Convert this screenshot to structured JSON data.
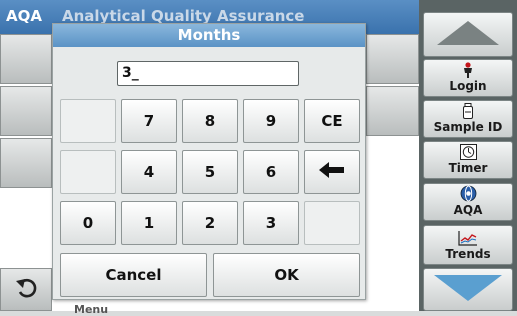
{
  "app": {
    "title_abbr": "AQA",
    "title_full": "Analytical Quality Assurance",
    "menu_label": "Menu"
  },
  "dialog": {
    "title": "Months",
    "input_value": "3_",
    "keys": {
      "k7": "7",
      "k8": "8",
      "k9": "9",
      "ce": "CE",
      "k4": "4",
      "k5": "5",
      "k6": "6",
      "k0": "0",
      "k1": "1",
      "k2": "2",
      "k3": "3"
    },
    "cancel_label": "Cancel",
    "ok_label": "OK"
  },
  "sidebar": {
    "login": "Login",
    "sample_id": "Sample ID",
    "timer": "Timer",
    "aqa": "AQA",
    "trends": "Trends"
  },
  "colors": {
    "title_bar": "#3a72ad",
    "dialog_title": "#6fa3d2",
    "panel": "#5a6464",
    "arrow": "#5a9fd0"
  }
}
